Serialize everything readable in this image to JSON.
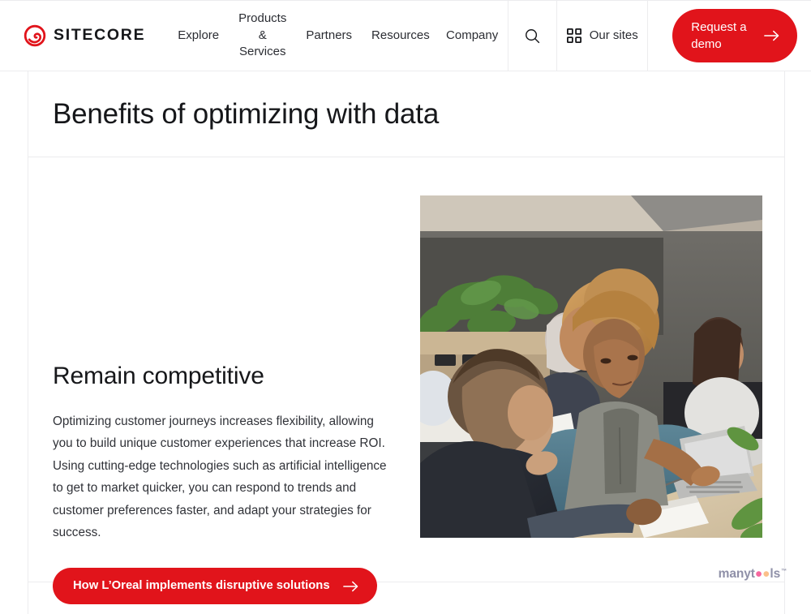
{
  "brand": {
    "name": "SITECORE",
    "logo_icon": "sitecore-swirl-icon",
    "accent_color": "#E1141B"
  },
  "header": {
    "nav_items": [
      {
        "label": "Explore"
      },
      {
        "label": "Products & Services"
      },
      {
        "label": "Partners"
      },
      {
        "label": "Resources"
      },
      {
        "label": "Company"
      }
    ],
    "search_icon": "search-icon",
    "sites": {
      "icon": "grid-apps-icon",
      "label": "Our sites"
    },
    "cta": {
      "label": "Request a demo",
      "icon": "arrow-right-icon",
      "background": "#E1141B",
      "text_color": "#FFFFFF"
    }
  },
  "main": {
    "page_title": "Benefits of optimizing with data",
    "feature": {
      "heading": "Remain competitive",
      "body": "Optimizing customer journeys increases flexibility, allowing you to build unique customer experiences that increase ROI. Using cutting-edge technologies such as artificial intelligence to get to market quicker, you can respond to trends and customer preferences faster, and adapt your strategies for success.",
      "cta": {
        "label": "How L’Oreal implements disruptive solutions",
        "icon": "arrow-right-icon",
        "background": "#E1141B",
        "text_color": "#FFFFFF"
      },
      "image_alt": "Team of colleagues collaborating around a laptop in a modern office"
    }
  },
  "watermark": {
    "prefix": "manyt",
    "dot_one": "●",
    "dot_two": "●",
    "suffix": "ls",
    "trademark": "™",
    "colors": {
      "text": "#8F90A8",
      "dot_one": "#F5679F",
      "dot_two": "#FBC08A"
    }
  }
}
